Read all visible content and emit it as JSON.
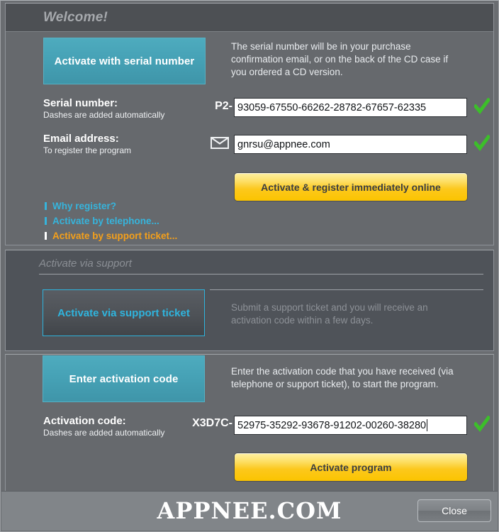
{
  "window": {
    "welcome_panel": {
      "title": "Welcome!",
      "primary_button": "Activate with serial number",
      "description": "The serial number will be in your purchase confirmation email, or on the back of the CD case if you ordered a CD version.",
      "serial_field": {
        "label": "Serial number:",
        "hint": "Dashes are added automatically",
        "prefix": "P2-",
        "value": "93059-67550-66262-28782-67657-62335",
        "valid_icon": "green-check-icon"
      },
      "email_field": {
        "label": "Email address:",
        "hint": "To register the program",
        "icon": "envelope-icon",
        "value": "gnrsu@appnee.com",
        "valid_icon": "green-check-icon"
      },
      "submit_button": "Activate & register immediately online",
      "links": [
        {
          "label": "Why register?",
          "state": "normal"
        },
        {
          "label": "Activate by telephone...",
          "state": "normal"
        },
        {
          "label": "Activate by support ticket...",
          "state": "active"
        }
      ]
    },
    "support_panel": {
      "title": "Activate via support",
      "button": "Activate via support ticket",
      "description": "Submit a support ticket and you will receive an activation code within a few days."
    },
    "code_panel": {
      "button": "Enter activation code",
      "description": "Enter the activation code that you have received (via telephone or support ticket), to start the program.",
      "code_field": {
        "label": "Activation code:",
        "hint": "Dashes are added automatically",
        "prefix": "X3D7C-",
        "value": "52975-35292-93678-91202-00260-38280",
        "valid_icon": "green-check-icon"
      },
      "submit_button": "Activate program"
    },
    "footer": {
      "watermark": "APPNEE.COM",
      "close_button": "Close"
    }
  },
  "colors": {
    "teal": "#46a2b6",
    "yellow": "#fcc81c",
    "link_cyan": "#36b4dc",
    "link_orange": "#f5a01a",
    "check_green": "#3cbf2a",
    "panel_light": "#66696d",
    "panel_dark": "#4f5359",
    "title_bar": "#4d5054"
  }
}
